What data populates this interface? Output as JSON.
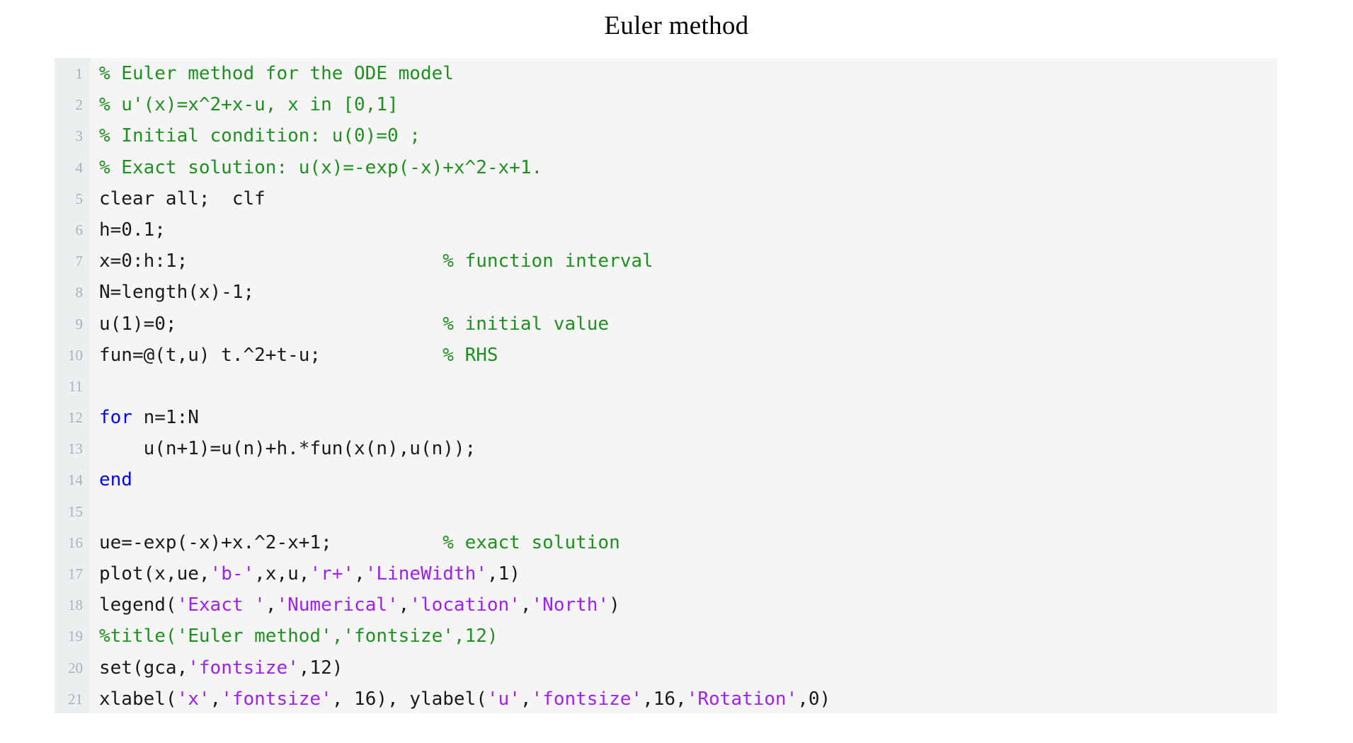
{
  "title": "Euler method",
  "colors": {
    "comment": "#1f9020",
    "keyword": "#0000ff",
    "string": "#a020f0",
    "plain": "#1a1a1a",
    "code_background": "#f5f5f5",
    "gutter_background": "#eceff0",
    "lineno": "#a7b3bb",
    "page_background": "#ffffff"
  },
  "code": {
    "language": "matlab",
    "line_count": 21,
    "lines": [
      {
        "n": "1",
        "text": "% Euler method for the ODE model",
        "tokens": [
          {
            "t": "% Euler method for the ODE model",
            "c": "comment"
          }
        ]
      },
      {
        "n": "2",
        "text": "% u'(x)=x^2+x-u, x in [0,1]",
        "tokens": [
          {
            "t": "% u'(x)=x^2+x-u, x in [0,1]",
            "c": "comment"
          }
        ]
      },
      {
        "n": "3",
        "text": "% Initial condition: u(0)=0 ;",
        "tokens": [
          {
            "t": "% Initial condition: u(0)=0 ;",
            "c": "comment"
          }
        ]
      },
      {
        "n": "4",
        "text": "% Exact solution: u(x)=-exp(-x)+x^2-x+1.",
        "tokens": [
          {
            "t": "% Exact solution: u(x)=-exp(-x)+x^2-x+1.",
            "c": "comment"
          }
        ]
      },
      {
        "n": "5",
        "text": "clear all;  clf",
        "tokens": [
          {
            "t": "clear all;  clf",
            "c": "plain"
          }
        ]
      },
      {
        "n": "6",
        "text": "h=0.1;",
        "tokens": [
          {
            "t": "h=0.1;",
            "c": "plain"
          }
        ]
      },
      {
        "n": "7",
        "text": "x=0:h:1;                       % function interval",
        "tokens": [
          {
            "t": "x=0:h:1;                       ",
            "c": "plain"
          },
          {
            "t": "% function interval",
            "c": "comment"
          }
        ]
      },
      {
        "n": "8",
        "text": "N=length(x)-1;",
        "tokens": [
          {
            "t": "N=length(x)-1;",
            "c": "plain"
          }
        ]
      },
      {
        "n": "9",
        "text": "u(1)=0;                        % initial value",
        "tokens": [
          {
            "t": "u(1)=0;                        ",
            "c": "plain"
          },
          {
            "t": "% initial value",
            "c": "comment"
          }
        ]
      },
      {
        "n": "10",
        "text": "fun=@(t,u) t.^2+t-u;           % RHS",
        "tokens": [
          {
            "t": "fun=@(t,u) t.^2+t-u;           ",
            "c": "plain"
          },
          {
            "t": "% RHS",
            "c": "comment"
          }
        ]
      },
      {
        "n": "11",
        "text": "",
        "tokens": []
      },
      {
        "n": "12",
        "text": "for n=1:N",
        "tokens": [
          {
            "t": "for",
            "c": "keyword"
          },
          {
            "t": " n=1:N",
            "c": "plain"
          }
        ]
      },
      {
        "n": "13",
        "text": "    u(n+1)=u(n)+h.*fun(x(n),u(n));",
        "tokens": [
          {
            "t": "    u(n+1)=u(n)+h.*fun(x(n),u(n));",
            "c": "plain"
          }
        ]
      },
      {
        "n": "14",
        "text": "end",
        "tokens": [
          {
            "t": "end",
            "c": "keyword"
          }
        ]
      },
      {
        "n": "15",
        "text": "",
        "tokens": []
      },
      {
        "n": "16",
        "text": "ue=-exp(-x)+x.^2-x+1;          % exact solution",
        "tokens": [
          {
            "t": "ue=-exp(-x)+x.^2-x+1;          ",
            "c": "plain"
          },
          {
            "t": "% exact solution",
            "c": "comment"
          }
        ]
      },
      {
        "n": "17",
        "text": "plot(x,ue,'b-',x,u,'r+','LineWidth',1)",
        "tokens": [
          {
            "t": "plot(x,ue,",
            "c": "plain"
          },
          {
            "t": "'b-'",
            "c": "string"
          },
          {
            "t": ",x,u,",
            "c": "plain"
          },
          {
            "t": "'r+'",
            "c": "string"
          },
          {
            "t": ",",
            "c": "plain"
          },
          {
            "t": "'LineWidth'",
            "c": "string"
          },
          {
            "t": ",1)",
            "c": "plain"
          }
        ]
      },
      {
        "n": "18",
        "text": "legend('Exact ','Numerical','location','North')",
        "tokens": [
          {
            "t": "legend(",
            "c": "plain"
          },
          {
            "t": "'Exact '",
            "c": "string"
          },
          {
            "t": ",",
            "c": "plain"
          },
          {
            "t": "'Numerical'",
            "c": "string"
          },
          {
            "t": ",",
            "c": "plain"
          },
          {
            "t": "'location'",
            "c": "string"
          },
          {
            "t": ",",
            "c": "plain"
          },
          {
            "t": "'North'",
            "c": "string"
          },
          {
            "t": ")",
            "c": "plain"
          }
        ]
      },
      {
        "n": "19",
        "text": "%title('Euler method','fontsize',12)",
        "tokens": [
          {
            "t": "%title('Euler method','fontsize',12)",
            "c": "comment"
          }
        ]
      },
      {
        "n": "20",
        "text": "set(gca,'fontsize',12)",
        "tokens": [
          {
            "t": "set(gca,",
            "c": "plain"
          },
          {
            "t": "'fontsize'",
            "c": "string"
          },
          {
            "t": ",12)",
            "c": "plain"
          }
        ]
      },
      {
        "n": "21",
        "text": "xlabel('x','fontsize', 16), ylabel('u','fontsize',16,'Rotation',0)",
        "tokens": [
          {
            "t": "xlabel(",
            "c": "plain"
          },
          {
            "t": "'x'",
            "c": "string"
          },
          {
            "t": ",",
            "c": "plain"
          },
          {
            "t": "'fontsize'",
            "c": "string"
          },
          {
            "t": ", 16), ylabel(",
            "c": "plain"
          },
          {
            "t": "'u'",
            "c": "string"
          },
          {
            "t": ",",
            "c": "plain"
          },
          {
            "t": "'fontsize'",
            "c": "string"
          },
          {
            "t": ",16,",
            "c": "plain"
          },
          {
            "t": "'Rotation'",
            "c": "string"
          },
          {
            "t": ",0)",
            "c": "plain"
          }
        ]
      }
    ]
  }
}
